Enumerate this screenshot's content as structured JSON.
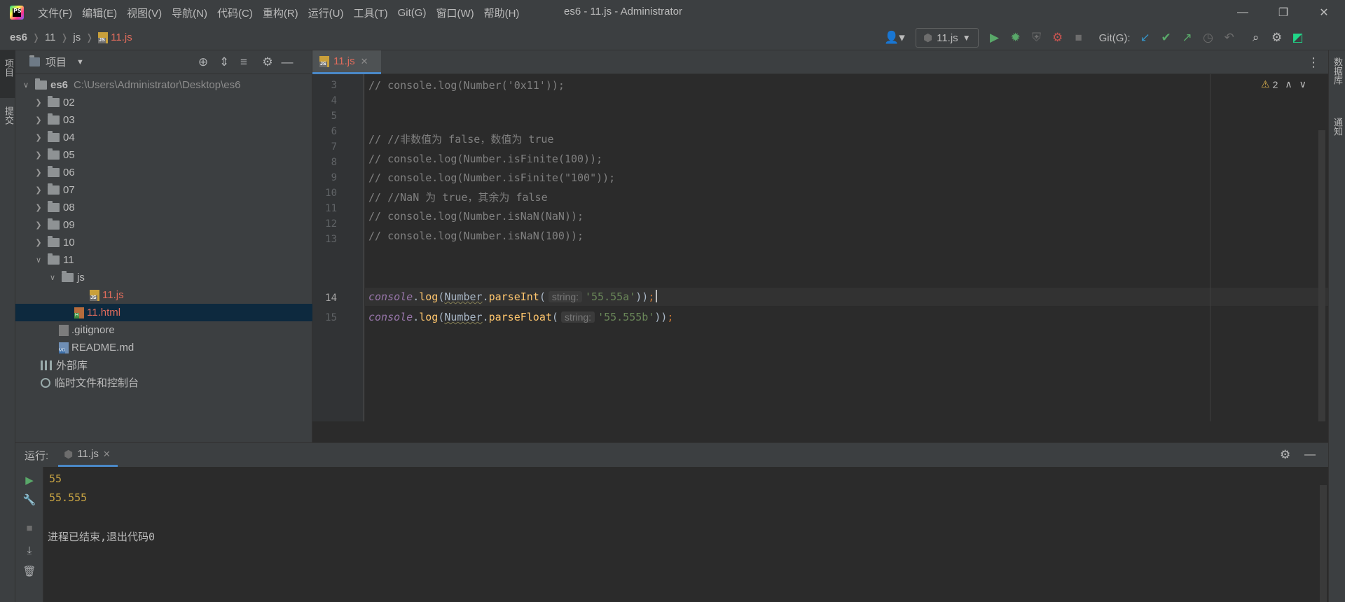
{
  "window": {
    "title": "es6 - 11.js - Administrator",
    "logo_text": "PS",
    "menu": [
      "文件(F)",
      "编辑(E)",
      "视图(V)",
      "导航(N)",
      "代码(C)",
      "重构(R)",
      "运行(U)",
      "工具(T)",
      "Git(G)",
      "窗口(W)",
      "帮助(H)"
    ]
  },
  "breadcrumb": [
    "es6",
    "11",
    "js",
    "11.js"
  ],
  "toolbar": {
    "run_config": "11.js",
    "git_label": "Git(G):"
  },
  "stripes": {
    "left_top": "项目",
    "left_mid": "提交",
    "right_top": "数据库",
    "right_mid": "通知"
  },
  "project": {
    "header": "项目",
    "root_name": "es6",
    "root_path": "C:\\Users\\Administrator\\Desktop\\es6",
    "folders": [
      "02",
      "03",
      "04",
      "05",
      "06",
      "07",
      "08",
      "09",
      "10"
    ],
    "open_folder": "11",
    "sub_folder": "js",
    "js_file": "11.js",
    "html_file": "11.html",
    "gitignore": ".gitignore",
    "readme": "README.md",
    "ext_libs": "外部库",
    "scratches": "临时文件和控制台"
  },
  "editor": {
    "tab_label": "11.js",
    "warning_count": "2",
    "line_numbers": [
      "3",
      "4",
      "5",
      "6",
      "7",
      "8",
      "9",
      "10",
      "11",
      "12",
      "13",
      "14",
      "15"
    ],
    "comment_lines": {
      "l3": "// console.log(Number('0x11'));",
      "l6": "// //非数值为 false，数值为 true",
      "l7": "// console.log(Number.isFinite(100));",
      "l8": "// console.log(Number.isFinite(\"100\"));",
      "l9": "// //NaN 为 true，其余为 false",
      "l10": "// console.log(Number.isNaN(NaN));",
      "l11": "// console.log(Number.isNaN(100));"
    },
    "line14": {
      "console": "console",
      "dot1": ".",
      "log": "log",
      "open": "(",
      "cls": "Number",
      "dot2": ".",
      "method": "parseInt",
      "open2": "(",
      "hint": "string:",
      "arg": "'55.55a'",
      "close": "))",
      "semi": ";"
    },
    "line15": {
      "console": "console",
      "dot1": ".",
      "log": "log",
      "open": "(",
      "cls": "Number",
      "dot2": ".",
      "method": "parseFloat",
      "open2": "(",
      "hint": "string:",
      "arg": "'55.555b'",
      "close": "))",
      "semi": ";"
    }
  },
  "run": {
    "label": "运行:",
    "tab_label": "11.js",
    "output": [
      "55",
      "55.555"
    ],
    "exit_message": "进程已结束,退出代码0"
  },
  "colors": {
    "accent": "#4a88c7",
    "run_green": "#59a869",
    "string_green": "#6a8759",
    "output_yellow": "#c8a443"
  }
}
